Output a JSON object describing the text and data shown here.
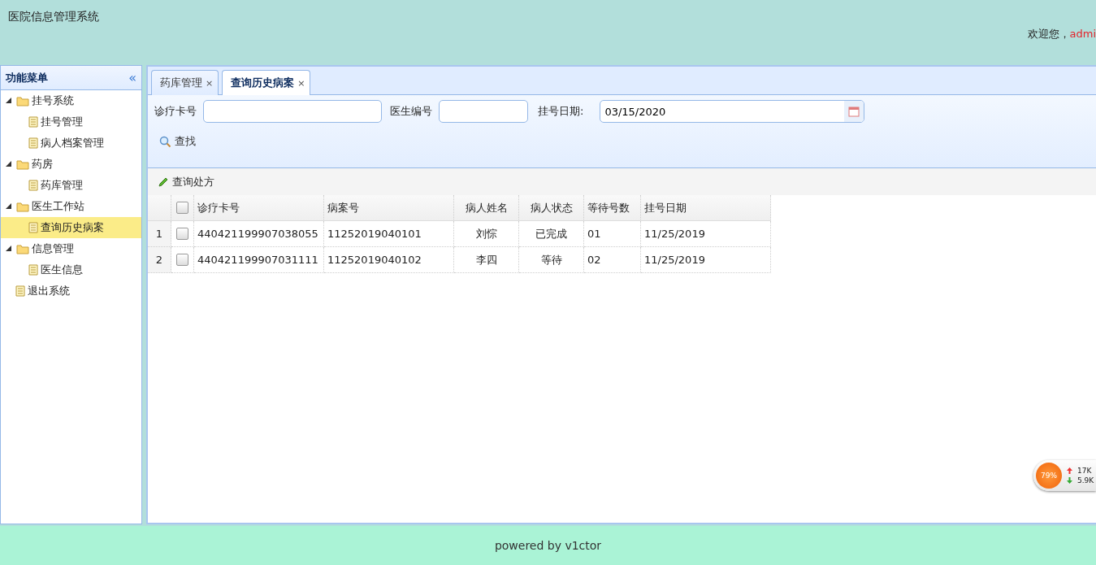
{
  "header": {
    "title": "医院信息管理系统",
    "welcome": "欢迎您，",
    "user": "admi"
  },
  "sidebar": {
    "title": "功能菜单",
    "collapse": "«",
    "items": [
      {
        "label": "挂号系统",
        "expanded": true,
        "selected": false,
        "children": [
          {
            "label": "挂号管理",
            "selected": false
          },
          {
            "label": "病人档案管理",
            "selected": false
          }
        ]
      },
      {
        "label": "药房",
        "expanded": true,
        "selected": false,
        "children": [
          {
            "label": "药库管理",
            "selected": false
          }
        ]
      },
      {
        "label": "医生工作站",
        "expanded": true,
        "selected": false,
        "children": [
          {
            "label": "查询历史病案",
            "selected": true
          }
        ]
      },
      {
        "label": "信息管理",
        "expanded": true,
        "selected": false,
        "children": [
          {
            "label": "医生信息",
            "selected": false
          }
        ]
      },
      {
        "label": "退出系统",
        "selected": false
      }
    ]
  },
  "tabs": [
    {
      "label": "药库管理",
      "close": "×",
      "selected": false
    },
    {
      "label": "查询历史病案",
      "close": "×",
      "selected": true
    }
  ],
  "search": {
    "fields": [
      {
        "label": "诊疗卡号",
        "kind": "text"
      },
      {
        "label": "医生编号",
        "kind": "text"
      },
      {
        "label": "挂号日期:",
        "value": "03/15/2020",
        "kind": "date"
      }
    ],
    "button": "查找"
  },
  "toolbar": {
    "button": "查询处方"
  },
  "table": {
    "header_checked": false,
    "columns": [
      "诊疗卡号",
      "病案号",
      "病人姓名",
      "病人状态",
      "等待号数",
      "挂号日期"
    ],
    "rows": [
      {
        "number": "1",
        "checked": false,
        "cells": [
          "440421199907038055",
          "11252019040101",
          "刘悰",
          "已完成",
          "01",
          "11/25/2019"
        ]
      },
      {
        "number": "2",
        "checked": false,
        "cells": [
          "440421199907031111",
          "11252019040102",
          "李四",
          "等待",
          "02",
          "11/25/2019"
        ]
      }
    ]
  },
  "footer": "powered by v1ctor",
  "net_widget": {
    "percent": "79%",
    "upload": "17K",
    "download": "5.9K"
  }
}
